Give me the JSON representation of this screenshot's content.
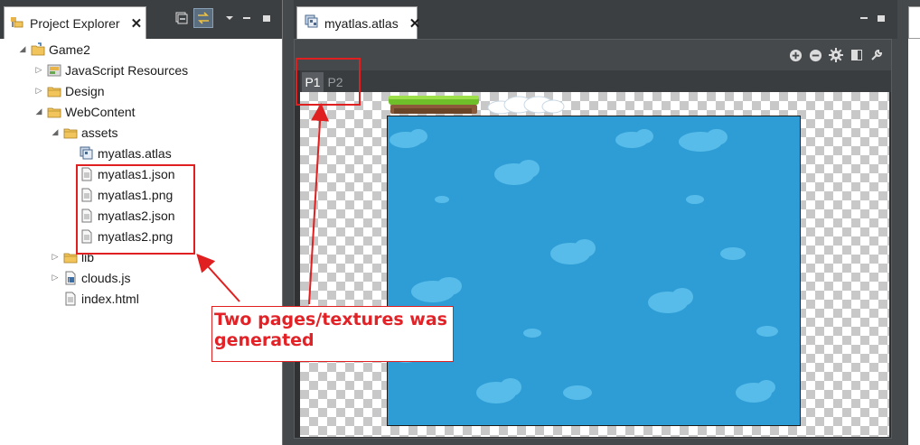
{
  "explorer": {
    "tab_title": "Project Explorer",
    "close_glyph": "✕",
    "toolbar_icons": [
      "collapse-all-icon",
      "link-with-editor-icon",
      "view-menu-icon",
      "minimize-icon",
      "maximize-icon"
    ]
  },
  "tree": [
    {
      "label": "Game2",
      "indent": 0,
      "arrow": "open",
      "icon": "project-folder-icon"
    },
    {
      "label": "JavaScript Resources",
      "indent": 1,
      "arrow": "closed",
      "icon": "js-resources-icon"
    },
    {
      "label": "Design",
      "indent": 1,
      "arrow": "closed",
      "icon": "folder-icon"
    },
    {
      "label": "WebContent",
      "indent": 1,
      "arrow": "open",
      "icon": "folder-icon"
    },
    {
      "label": "assets",
      "indent": 2,
      "arrow": "open",
      "icon": "folder-icon"
    },
    {
      "label": "myatlas.atlas",
      "indent": 3,
      "arrow": "none",
      "icon": "atlas-file-icon"
    },
    {
      "label": "myatlas1.json",
      "indent": 3,
      "arrow": "none",
      "icon": "file-icon"
    },
    {
      "label": "myatlas1.png",
      "indent": 3,
      "arrow": "none",
      "icon": "file-icon"
    },
    {
      "label": "myatlas2.json",
      "indent": 3,
      "arrow": "none",
      "icon": "file-icon"
    },
    {
      "label": "myatlas2.png",
      "indent": 3,
      "arrow": "none",
      "icon": "file-icon"
    },
    {
      "label": "lib",
      "indent": 2,
      "arrow": "closed",
      "icon": "folder-icon"
    },
    {
      "label": "clouds.js",
      "indent": 2,
      "arrow": "closed",
      "icon": "js-file-icon"
    },
    {
      "label": "index.html",
      "indent": 2,
      "arrow": "none",
      "icon": "file-icon"
    }
  ],
  "editor": {
    "tab_title": "myatlas.atlas",
    "close_glyph": "✕",
    "toolbar_icons": [
      "zoom-in-icon",
      "zoom-out-icon",
      "settings-icon",
      "layout-icon",
      "wrench-icon"
    ],
    "pages": [
      {
        "label": "P1",
        "selected": true
      },
      {
        "label": "P2",
        "selected": false
      }
    ]
  },
  "annotation": {
    "text": "Two pages/textures was generated",
    "color": "#e32227"
  },
  "colors": {
    "texture_bg": "#2f9dd5",
    "cloud": "#5cc0ec"
  }
}
